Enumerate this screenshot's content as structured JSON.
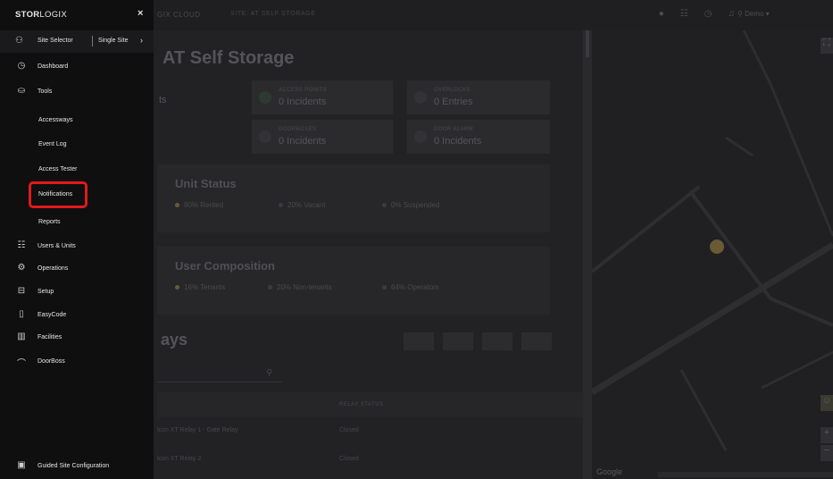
{
  "sidebar": {
    "logo_bold": "STOR",
    "logo_rest": "LOGIX",
    "close_glyph": "×",
    "site_selector": {
      "label": "Site Selector",
      "mode": "Single Site",
      "chevron": "›",
      "icon": "sitemap-icon"
    },
    "nav": [
      {
        "label": "Dashboard",
        "icon": "dashboard-icon",
        "glyph": "◷"
      },
      {
        "label": "Tools",
        "icon": "tools-icon",
        "glyph": "⛀"
      },
      {
        "label": "Accessways",
        "sub": true
      },
      {
        "label": "Event Log",
        "sub": true
      },
      {
        "label": "Access Tester",
        "sub": true
      },
      {
        "label": "Notifications",
        "sub": true,
        "highlighted": true
      },
      {
        "label": "Reports",
        "sub": true
      },
      {
        "label": "Users & Units",
        "icon": "users-icon",
        "glyph": "☷"
      },
      {
        "label": "Operations",
        "icon": "operations-icon",
        "glyph": "⚙"
      },
      {
        "label": "Setup",
        "icon": "setup-icon",
        "glyph": "⊟"
      },
      {
        "label": "EasyCode",
        "icon": "easycode-icon",
        "glyph": "▯"
      },
      {
        "label": "Facilities",
        "icon": "facilities-icon",
        "glyph": "▥"
      },
      {
        "label": "DoorBoss",
        "icon": "doorboss-icon",
        "glyph": "⌒"
      }
    ],
    "guided": {
      "label": "Guided Site Configuration",
      "glyph": "▣"
    },
    "highlight_color": "#e01a1a"
  },
  "topbar": {
    "brand_fragment": "GIX CLOUD",
    "site_label": "SITE: AT SELF STORAGE",
    "user": "Demo ▾"
  },
  "main": {
    "title": "AT Self Storage",
    "stats": {
      "frag_ts": "ts",
      "access_points_label": "ACCESS POINTS",
      "access_points_value": "0 Incidents",
      "overlocks_label": "OVERLOCKS",
      "overlocks_value": "0 Entries",
      "doorbox_label": "DOORBOXES",
      "doorbox_value": "0 Incidents",
      "door_alarm_label": "DOOR ALARM",
      "door_alarm_value": "0 Incidents"
    },
    "unit_status": {
      "title": "Unit Status",
      "legend": [
        "80% Rented",
        "20% Vacant",
        "0% Suspended"
      ]
    },
    "user_composition": {
      "title": "User Composition",
      "legend": [
        "16% Tenants",
        "20% Non-tenants",
        "64% Operators"
      ]
    },
    "accessways_fragment": "ays",
    "table": {
      "header_relay": "RELAY STATUS",
      "rows": [
        {
          "name": "lcon XT Relay 1 - Gate Relay",
          "status": "Closed"
        },
        {
          "name": "lcon XT Relay 2",
          "status": "Closed"
        }
      ]
    }
  },
  "map": {
    "google": "Google",
    "zoom_in": "+",
    "zoom_out": "−"
  }
}
